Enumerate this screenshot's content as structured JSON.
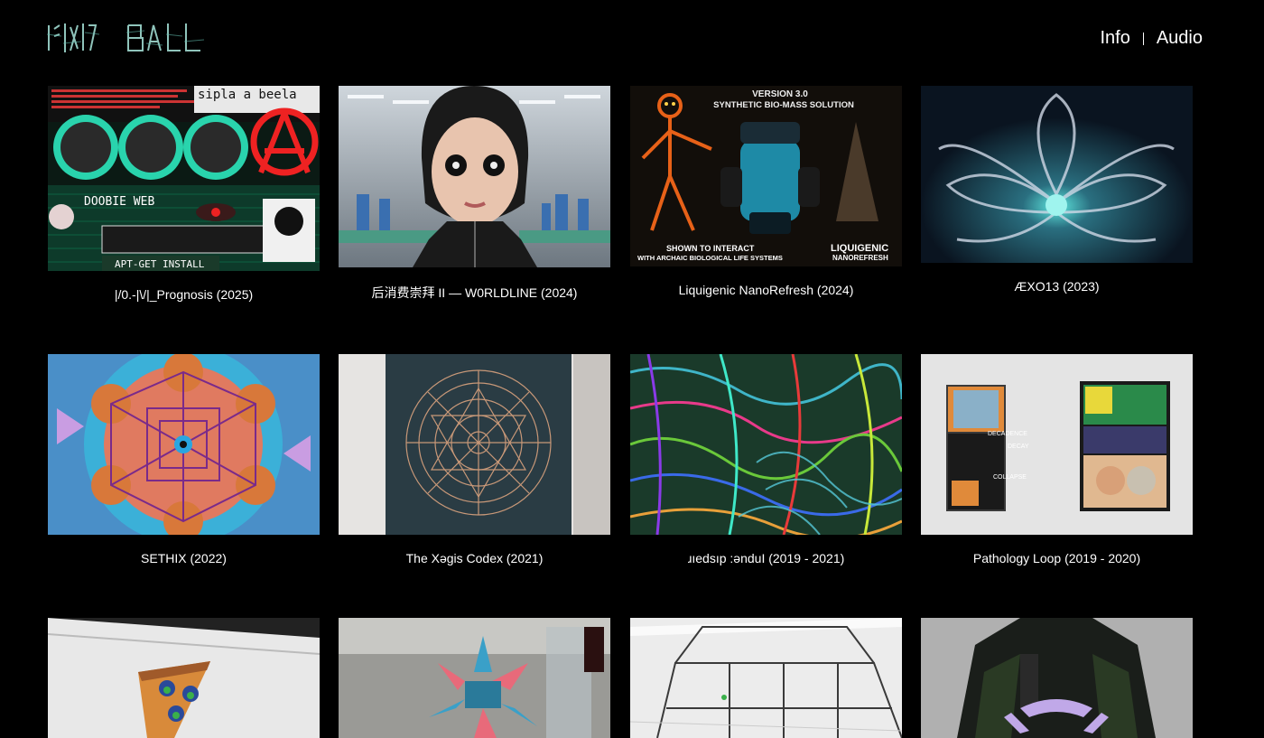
{
  "header": {
    "logo_text": "ᛁᛊᛁᛉ ᛒᛖᛚᛚ",
    "nav": [
      {
        "label": "Info"
      },
      {
        "label": "Audio"
      }
    ]
  },
  "works": [
    {
      "title": "|/0.-|\\/|_Prognosis (2025)",
      "overlay_top": "sipla a beela",
      "overlay_mid": "DOOBIE WEB",
      "overlay_bottom": "APT-GET INSTALL"
    },
    {
      "title": "后消费崇拜 II — W0RLDLINE (2024)"
    },
    {
      "title": "Liquigenic NanoRefresh (2024)",
      "overlay_top": "VERSION 3.0",
      "overlay_sub": "SYNTHETIC BIO-MASS SOLUTION",
      "overlay_left": "SHOWN TO INTERACT",
      "overlay_left2": "WITH ARCHAIC BIOLOGICAL LIFE SYSTEMS",
      "overlay_right": "LIQUIGENIC",
      "overlay_right2": "NANOREFRESH"
    },
    {
      "title": "ÆXO13 (2023)"
    },
    {
      "title": "SETHIX (2022)"
    },
    {
      "title": "The Xəgis Codex (2021)"
    },
    {
      "title": "ɹıedsıp :ǝnduI (2019 - 2021)"
    },
    {
      "title": "Pathology Loop (2019 - 2020)",
      "overlay_1": "DECADENCE",
      "overlay_2": "DECAY",
      "overlay_3": "COLLAPSE"
    },
    {
      "title": ""
    },
    {
      "title": ""
    },
    {
      "title": ""
    },
    {
      "title": ""
    }
  ],
  "colors": {
    "background": "#000000",
    "text": "#ffffff",
    "logo": "#7fd8c8"
  }
}
